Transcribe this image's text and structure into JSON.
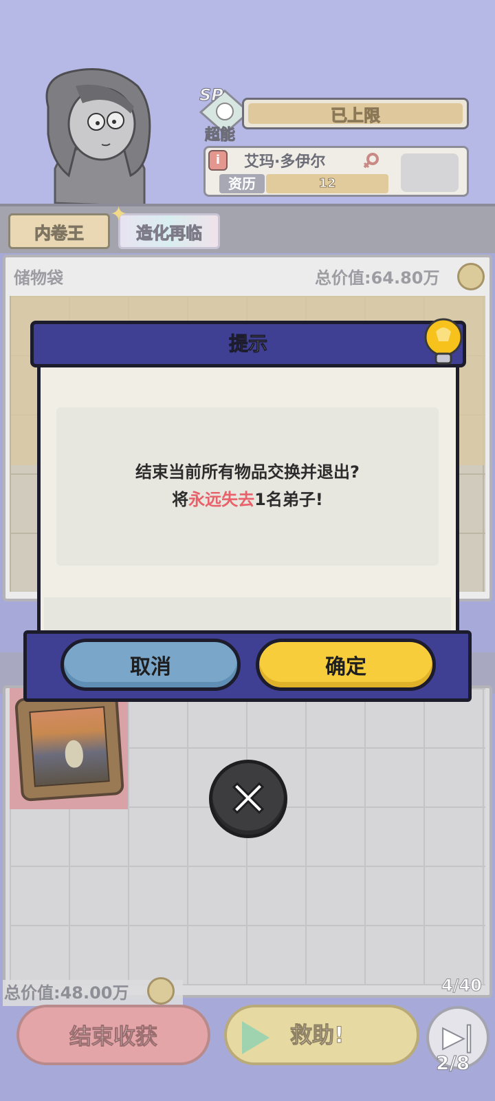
{
  "character": {
    "sp_label": "SP",
    "sp_type": "超能",
    "limit_text": "已上限",
    "name": "艾玛·多伊尔",
    "exp_label": "资历",
    "exp_value": "12"
  },
  "tabs": [
    "内卷王",
    "造化再临"
  ],
  "bag": {
    "title": "储物袋",
    "total": "总价值:64.80万"
  },
  "inventory": {
    "total": "总价值:48.00万",
    "count": "4/40"
  },
  "bottom": {
    "end_label": "结束收获",
    "rescue_label": "救助!",
    "skip_count": "2/8"
  },
  "dialog": {
    "title": "提示",
    "line1": "结束当前所有物品交换并退出?",
    "line2_prefix": "将",
    "line2_highlight": "永远失去",
    "line2_suffix": "1名弟子!",
    "cancel_label": "取消",
    "confirm_label": "确定",
    "highlight_color": "#e8616a"
  },
  "icons": {
    "close": "close-icon",
    "bulb": "lightbulb-icon",
    "female": "female-icon",
    "coin": "coin-icon",
    "play": "play-icon",
    "skip": "skip-icon"
  }
}
